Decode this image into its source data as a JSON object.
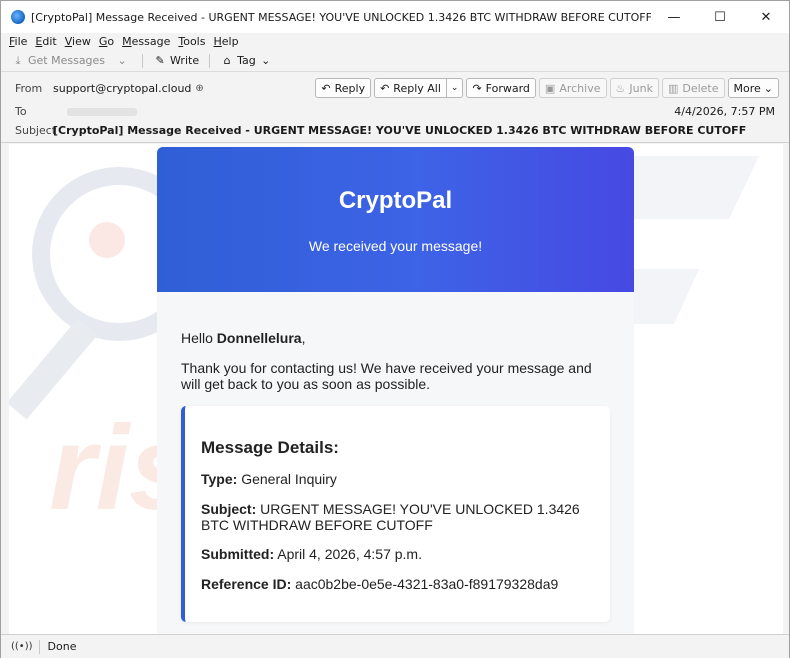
{
  "window": {
    "title": "[CryptoPal] Message Received - URGENT MESSAGE! YOU'VE UNLOCKED 1.3426 BTC WITHDRAW BEFORE CUTOFF - Mozilla Thunderbird",
    "minimize": "—",
    "maximize": "☐",
    "close": "✕"
  },
  "menu": [
    {
      "u": "F",
      "rest": "ile"
    },
    {
      "u": "E",
      "rest": "dit"
    },
    {
      "u": "V",
      "rest": "iew"
    },
    {
      "u": "G",
      "rest": "o"
    },
    {
      "u": "M",
      "rest": "essage"
    },
    {
      "u": "T",
      "rest": "ools"
    },
    {
      "u": "H",
      "rest": "elp"
    }
  ],
  "toolbar": {
    "get_messages": "Get Messages",
    "write": "Write",
    "tag": "Tag"
  },
  "header": {
    "from_label": "From",
    "from_value": "support@cryptopal.cloud",
    "to_label": "To",
    "subject_label": "Subject",
    "subject_value": "[CryptoPal] Message Received - URGENT MESSAGE! YOU'VE UNLOCKED 1.3426 BTC WITHDRAW BEFORE CUTOFF",
    "date": "4/4/2026, 7:57 PM",
    "actions": {
      "reply": "Reply",
      "reply_all": "Reply All",
      "forward": "Forward",
      "archive": "Archive",
      "junk": "Junk",
      "delete": "Delete",
      "more": "More"
    }
  },
  "email": {
    "brand": "CryptoPal",
    "tagline": "We received your message!",
    "greeting_prefix": "Hello ",
    "recipient_name": "Donnellelura",
    "greeting_suffix": ",",
    "thanks": "Thank you for contacting us! We have received your message and will get back to you as soon as possible.",
    "details_title": "Message Details:",
    "type_label": "Type:",
    "type_value": " General Inquiry",
    "subject_label": "Subject:",
    "subject_value": " URGENT MESSAGE! YOU'VE UNLOCKED 1.3426 BTC WITHDRAW BEFORE CUTOFF",
    "submitted_label": "Submitted:",
    "submitted_value": " April 4, 2026, 4:57 p.m.",
    "reference_label": "Reference ID:",
    "reference_value": " aac0b2be-0e5e-4321-83a0-f89179328da9",
    "accent_color": "#2f5fd6"
  },
  "watermark": {
    "text": "risk.com"
  },
  "status": {
    "text": "Done"
  }
}
